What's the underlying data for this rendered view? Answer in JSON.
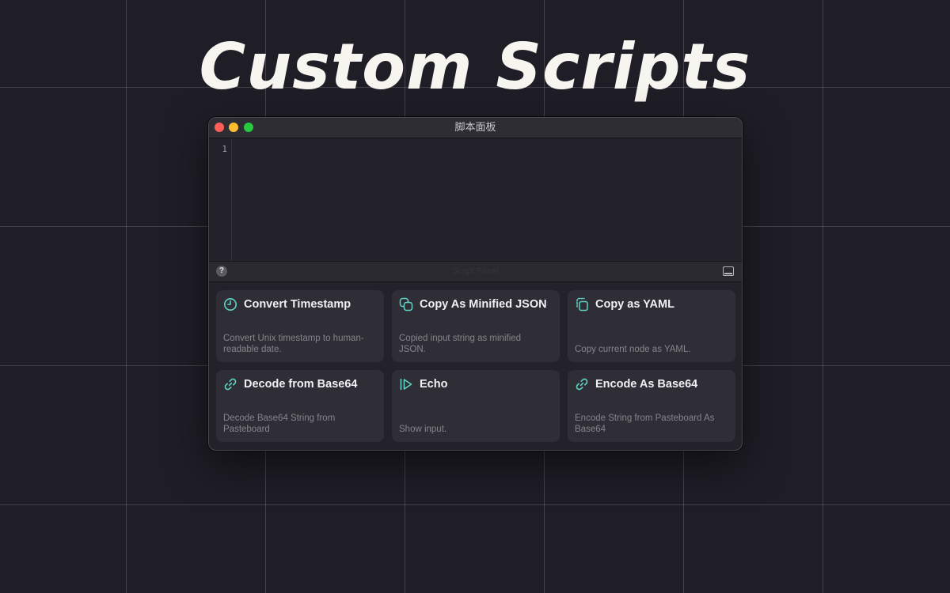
{
  "hero": {
    "title": "Custom Scripts"
  },
  "window": {
    "title": "脚本面板"
  },
  "editor": {
    "line_numbers": [
      "1"
    ],
    "content": ""
  },
  "status_bar": {
    "help_label": "?",
    "text": "Script Panel"
  },
  "scripts": [
    {
      "title": "Convert Timestamp",
      "description": "Convert Unix timestamp to human-readable date.",
      "icon": "clock-icon"
    },
    {
      "title": "Copy As Minified JSON",
      "description": "Copied input string as minified JSON.",
      "icon": "copy-icon"
    },
    {
      "title": "Copy as YAML",
      "description": "Copy current node as YAML.",
      "icon": "copy-document-icon"
    },
    {
      "title": "Decode from Base64",
      "description": "Decode Base64 String from Pasteboard",
      "icon": "link-icon"
    },
    {
      "title": "Echo",
      "description": "Show input.",
      "icon": "play-icon"
    },
    {
      "title": "Encode As Base64",
      "description": "Encode String from Pasteboard As Base64",
      "icon": "link-icon"
    }
  ],
  "colors": {
    "background": "#1f1e27",
    "accent_teal": "#5fd4c4",
    "card": "#2f2e36",
    "traffic_close": "#ff5f57",
    "traffic_minimize": "#febc2e",
    "traffic_maximize": "#28c840"
  }
}
